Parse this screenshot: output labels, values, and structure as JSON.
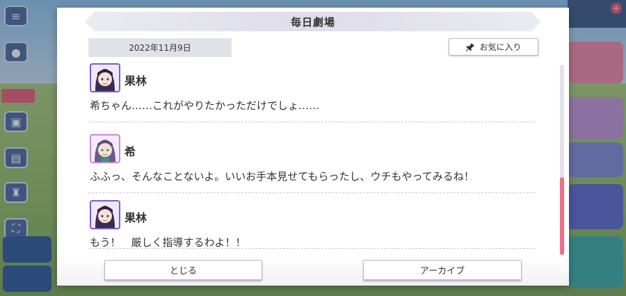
{
  "dialog": {
    "title": "毎日劇場",
    "date": "2022年11月9日",
    "favorite_label": "お気に入り",
    "close_label": "とじる",
    "archive_label": "アーカイブ"
  },
  "entries": [
    {
      "speaker": "果林",
      "text": "希ちゃん……これがやりたかっただけでしょ……"
    },
    {
      "speaker": "希",
      "text": "ふふっ、そんなことないよ。いいお手本見せてもらったし、ウチもやってみるね！"
    },
    {
      "speaker": "果林",
      "text": "もう！　厳しく指導するわよ！！"
    }
  ],
  "icons": {
    "favorite": "pin-icon",
    "avatar_1": "karin-avatar",
    "avatar_2": "nozomi-avatar",
    "avatar_3": "karin-avatar"
  },
  "colors": {
    "scroll_thumb": "#f06f86",
    "karin_frame": "#7c5cc9",
    "nozomi_frame": "#c98ad6"
  }
}
